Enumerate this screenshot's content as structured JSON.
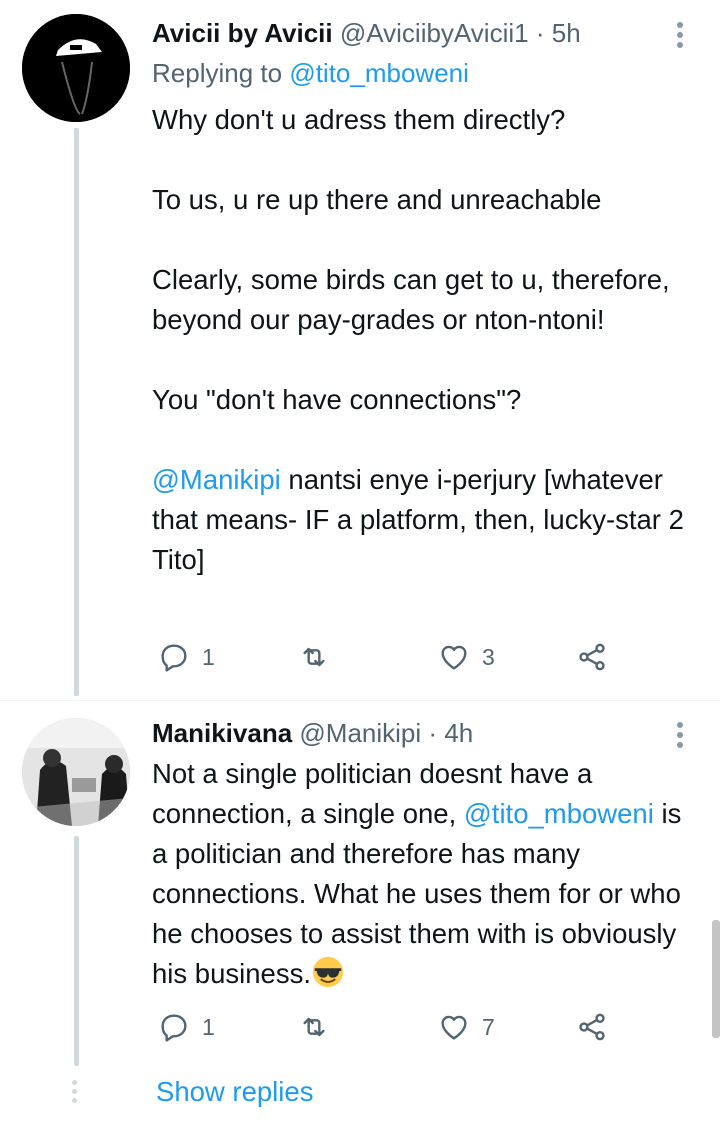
{
  "tweets": [
    {
      "name": "Avicii by Avicii",
      "handle": "@AviciibyAvicii1",
      "dot": "·",
      "time": "5h",
      "replying_prefix": "Replying to",
      "replying_handle": "@tito_mboweni",
      "paragraphs": [
        "Why don't u adress them directly?",
        "To us, u re up there and unreachable",
        "Clearly, some birds can get to u, therefore, beyond our pay-grades or nton-ntoni!",
        "You \"don't have connections\"?"
      ],
      "mention": "@Manikipi",
      "last_text": " nantsi enye i-perjury [whatever that means- IF a platform, then, lucky-star 2 Tito]",
      "reply_count": "1",
      "retweet_count": "",
      "like_count": "3"
    },
    {
      "name": "Manikivana",
      "handle": "@Manikipi",
      "dot": "·",
      "time": "4h",
      "text_before": "Not a single politician doesnt have a connection, a single one, ",
      "mention": "@tito_mboweni",
      "text_after": " is a politician and therefore has many connections. What he uses them for or who he chooses to assist them with is obviously his business.",
      "emoji": "sunglasses-emoji",
      "reply_count": "1",
      "retweet_count": "",
      "like_count": "7"
    }
  ],
  "show_replies": "Show replies",
  "colors": {
    "accent": "#1d9bf0",
    "secondary_text": "#536471",
    "thread_line": "#cfd9de",
    "primary_text": "#0f1419"
  }
}
